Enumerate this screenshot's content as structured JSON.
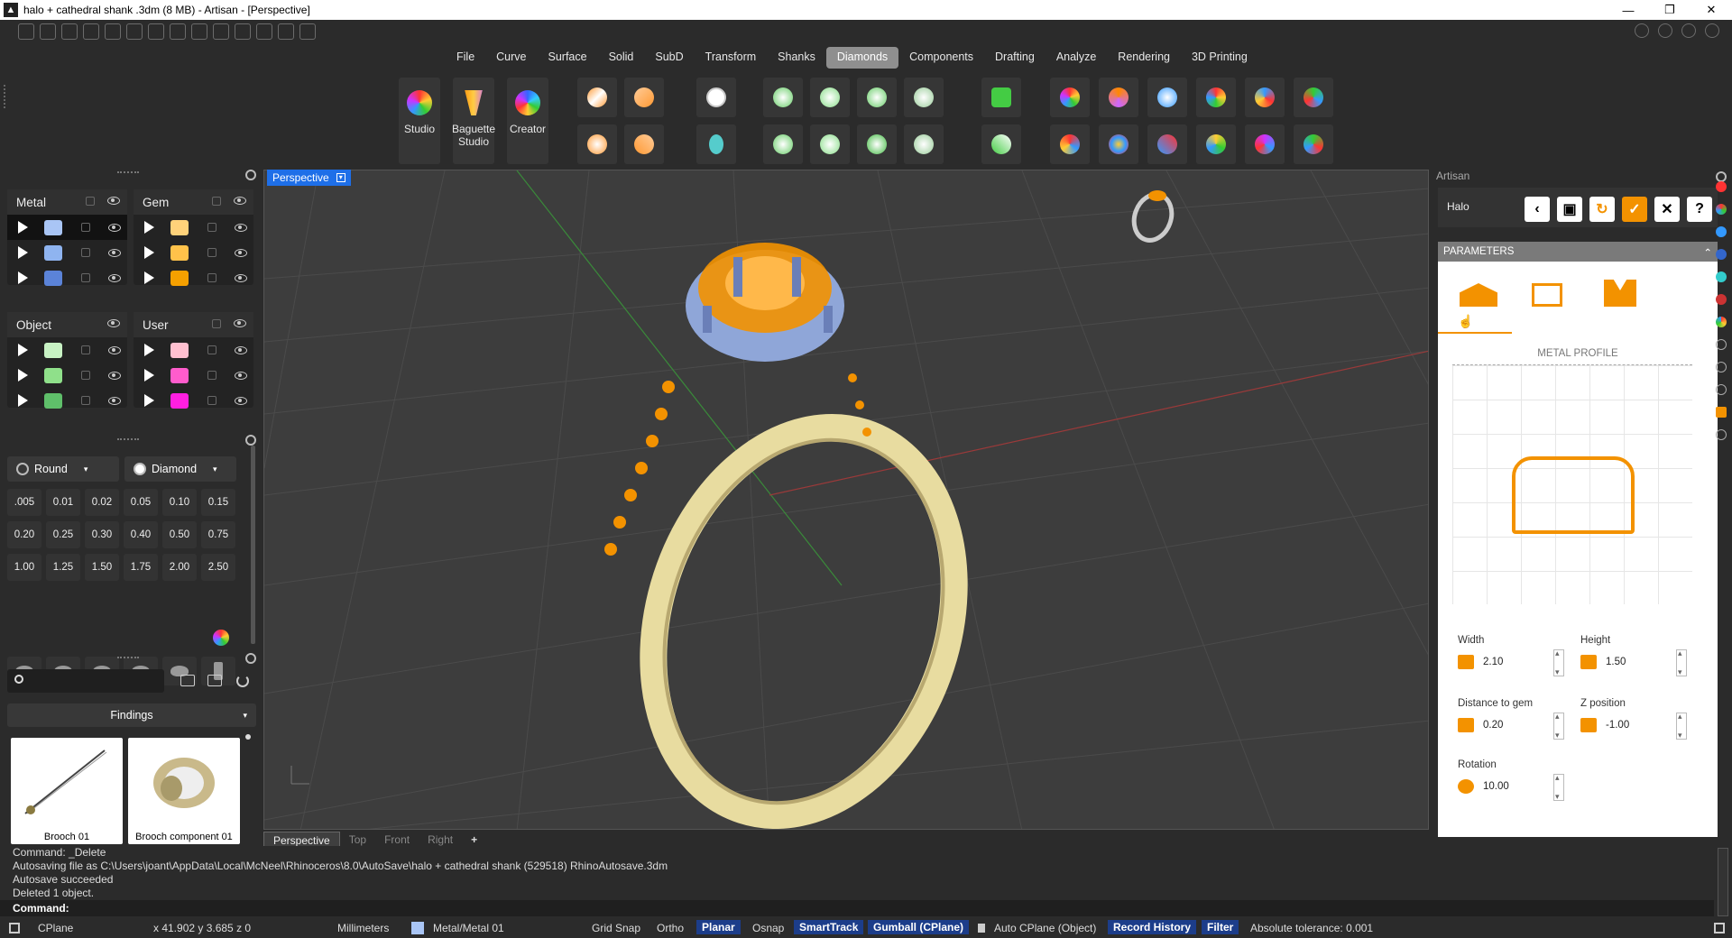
{
  "window": {
    "title": "halo + cathedral shank .3dm (8 MB) - Artisan - [Perspective]",
    "app_icon": "Rhino-icon"
  },
  "menu": [
    "File",
    "Curve",
    "Surface",
    "Solid",
    "SubD",
    "Transform",
    "Shanks",
    "Diamonds",
    "Components",
    "Drafting",
    "Analyze",
    "Rendering",
    "3D Printing"
  ],
  "menu_active": "Diamonds",
  "toolbar": {
    "studio": "Studio",
    "baguette_studio_1": "Baguette",
    "baguette_studio_2": "Studio",
    "creator": "Creator"
  },
  "layers": {
    "metal": "Metal",
    "gem": "Gem",
    "object": "Object",
    "user": "User",
    "colors": {
      "metal": [
        "#a9c5f5",
        "#8fb4f0",
        "#5b83d8"
      ],
      "gem": [
        "#ffd27a",
        "#ffc24a",
        "#f5a000"
      ],
      "object": [
        "#c8f2c4",
        "#8fe08a",
        "#5fbf6a"
      ],
      "user": [
        "#ffc0d0",
        "#ff5ccc",
        "#ff1fe0"
      ]
    }
  },
  "gems": {
    "shape": "Round",
    "cut": "Diamond",
    "sizes": [
      ".005",
      "0.01",
      "0.02",
      "0.05",
      "0.10",
      "0.15",
      "0.20",
      "0.25",
      "0.30",
      "0.40",
      "0.50",
      "0.75",
      "1.00",
      "1.25",
      "1.50",
      "1.75",
      "2.00",
      "2.50"
    ]
  },
  "findings": {
    "label": "Findings",
    "items": [
      "Brooch 01",
      "Brooch component 01"
    ]
  },
  "viewport": {
    "name": "Perspective",
    "tabs": [
      "Perspective",
      "Top",
      "Front",
      "Right"
    ]
  },
  "artisan": {
    "panel_title": "Artisan",
    "tool": "Halo",
    "section": "PARAMETERS",
    "profile_label": "METAL PROFILE",
    "width_label": "Width",
    "width": "2.10",
    "height_label": "Height",
    "height": "1.50",
    "dist_label": "Distance to gem",
    "dist": "0.20",
    "z_label": "Z position",
    "z": "-1.00",
    "rot_label": "Rotation",
    "rot": "10.00",
    "accent": "#f39200"
  },
  "command": {
    "history": [
      "Command: _Delete",
      "Autosaving file as C:\\Users\\joant\\AppData\\Local\\McNeel\\Rhinoceros\\8.0\\AutoSave\\halo + cathedral shank  (529518) RhinoAutosave.3dm",
      "Autosave succeeded",
      "Deleted 1 object."
    ],
    "prompt": "Command:"
  },
  "status": {
    "cplane": "CPlane",
    "coords": "x 41.902   y 3.685   z 0",
    "units": "Millimeters",
    "layer": "Metal/Metal 01",
    "grid_snap": "Grid Snap",
    "ortho": "Ortho",
    "planar": "Planar",
    "osnap": "Osnap",
    "smarttrack": "SmartTrack",
    "gumball": "Gumball (CPlane)",
    "auto_cplane": "Auto CPlane (Object)",
    "record_history": "Record History",
    "filter": "Filter",
    "tolerance": "Absolute tolerance: 0.001"
  }
}
